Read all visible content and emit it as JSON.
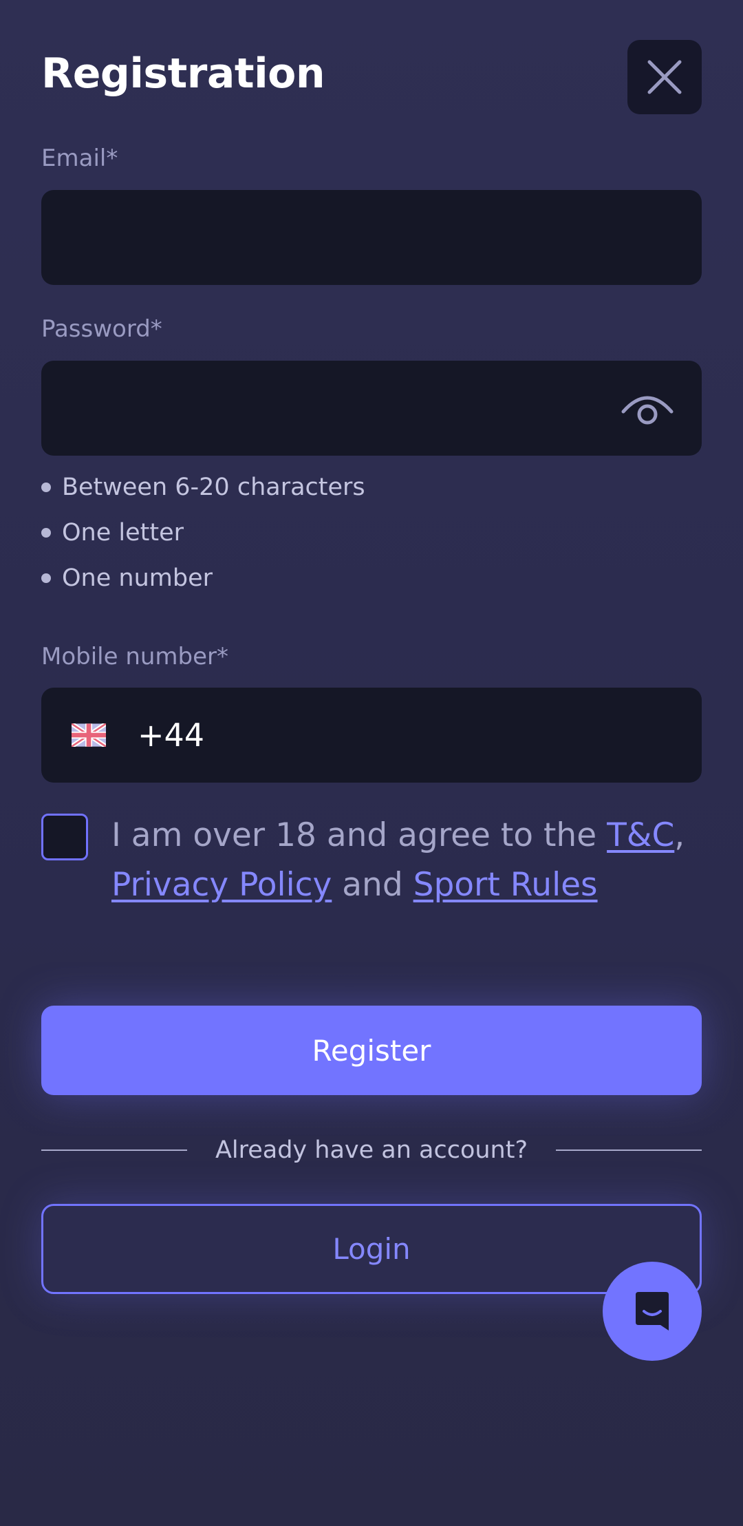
{
  "header": {
    "title": "Registration",
    "close_icon": "close-icon"
  },
  "form": {
    "email": {
      "label": "Email*",
      "value": "",
      "placeholder": ""
    },
    "password": {
      "label": "Password*",
      "value": "",
      "placeholder": "",
      "toggle_icon": "eye-icon",
      "rules": [
        "Between 6-20 characters",
        "One letter",
        "One number"
      ]
    },
    "mobile": {
      "label": "Mobile number*",
      "flag_icon": "uk-flag-icon",
      "prefix": "+44",
      "value": ""
    },
    "agreement": {
      "checked": false,
      "text_1": "I am over 18 and agree to the ",
      "link_tc": "T&C",
      "text_2": ",",
      "link_privacy": "Privacy Policy",
      "text_3": " and ",
      "link_sport": "Sport Rules"
    },
    "register_label": "Register"
  },
  "login_section": {
    "divider_text": "Already have an account?",
    "login_label": "Login"
  },
  "chat": {
    "icon": "chat-icon"
  },
  "colors": {
    "background": "#2f2f53",
    "field": "#151726",
    "accent": "#7274ff",
    "link": "#8588ff",
    "label": "#9a9bc2"
  }
}
